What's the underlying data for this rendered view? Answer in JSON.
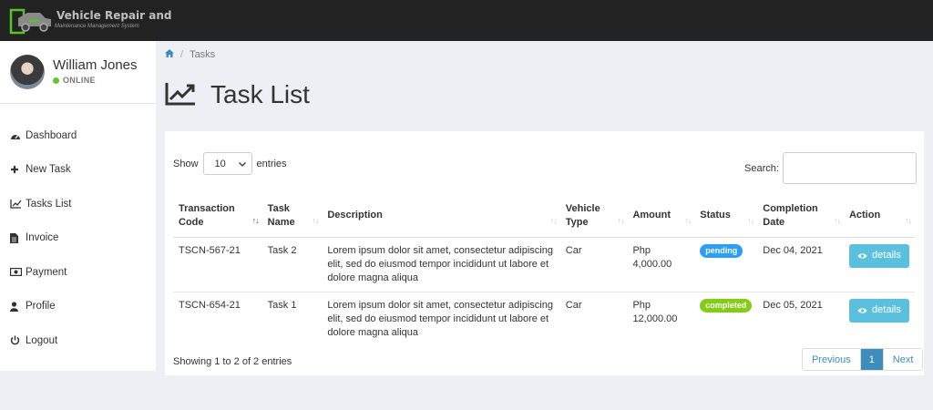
{
  "app": {
    "logo_title": "Vehicle Repair and",
    "logo_subtitle": "Maintenance Management System"
  },
  "user": {
    "name": "William Jones",
    "status": "ONLINE",
    "status_color": "#65c22f"
  },
  "sidebar": {
    "items": [
      {
        "label": "Dashboard",
        "icon": "dashboard-icon"
      },
      {
        "label": "New Task",
        "icon": "plus-icon"
      },
      {
        "label": "Tasks List",
        "icon": "line-chart-icon"
      },
      {
        "label": "Invoice",
        "icon": "file-icon"
      },
      {
        "label": "Payment",
        "icon": "money-icon"
      },
      {
        "label": "Profile",
        "icon": "user-icon"
      },
      {
        "label": "Logout",
        "icon": "power-icon"
      }
    ]
  },
  "breadcrumb": {
    "home_icon": "home-icon",
    "current": "Tasks"
  },
  "page": {
    "title": "Task List",
    "title_icon": "line-chart-icon"
  },
  "table_controls": {
    "show_label": "Show",
    "entries_value": "10",
    "entries_label": "entries",
    "search_label": "Search:",
    "search_value": ""
  },
  "table": {
    "columns": [
      {
        "label": "Transaction Code",
        "sort": "asc"
      },
      {
        "label": "Task Name",
        "sort": "none"
      },
      {
        "label": "Description",
        "sort": "none"
      },
      {
        "label": "Vehicle Type",
        "sort": "none"
      },
      {
        "label": "Amount",
        "sort": "none"
      },
      {
        "label": "Status",
        "sort": "none"
      },
      {
        "label": "Completion Date",
        "sort": "none"
      },
      {
        "label": "Action",
        "sort": "none"
      }
    ],
    "rows": [
      {
        "code": "TSCN-567-21",
        "task": "Task 2",
        "description": "Lorem ipsum dolor sit amet, consectetur adipiscing elit, sed do eiusmod tempor incididunt ut labore et dolore magna aliqua",
        "vehicle": "Car",
        "amount": "Php 4,000.00",
        "status": "pending",
        "status_color": "#2b9ef5",
        "date": "Dec 04, 2021",
        "action": "details"
      },
      {
        "code": "TSCN-654-21",
        "task": "Task 1",
        "description": "Lorem ipsum dolor sit amet, consectetur adipiscing elit, sed do eiusmod tempor incididunt ut labore et dolore magna aliqua",
        "vehicle": "Car",
        "amount": "Php 12,000.00",
        "status": "completed",
        "status_color": "#84cc16",
        "date": "Dec 05, 2021",
        "action": "details"
      }
    ]
  },
  "footer": {
    "info": "Showing 1 to 2 of 2 entries",
    "prev": "Previous",
    "page": "1",
    "next": "Next"
  },
  "colors": {
    "topbar": "#222222",
    "accent": "#3c8dbc",
    "details_button": "#5bc0de"
  }
}
